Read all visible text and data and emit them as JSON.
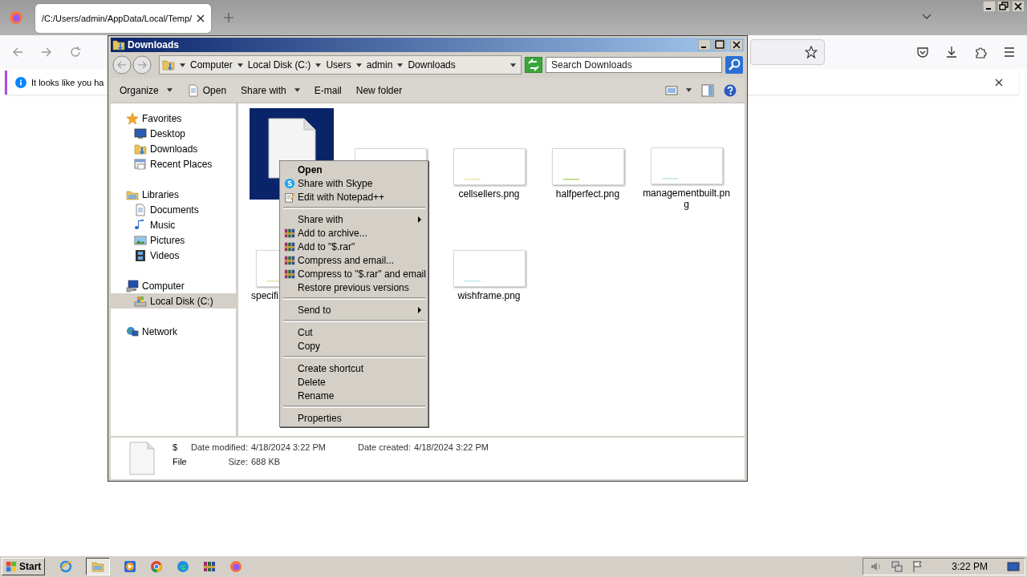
{
  "browser": {
    "tabs": [
      {
        "title": "/C:/Users/admin/AppData/Local/Temp/",
        "selected": true
      }
    ],
    "notification": "It looks like you ha"
  },
  "explorer": {
    "title": "Downloads",
    "breadcrumb": [
      "Computer",
      "Local Disk (C:)",
      "Users",
      "admin",
      "Downloads"
    ],
    "search": {
      "placeholder": "Search Downloads"
    },
    "commands": [
      {
        "label": "Organize",
        "menu": true
      },
      {
        "label": "Open",
        "menu": false
      },
      {
        "label": "Share with",
        "menu": true
      },
      {
        "label": "E-mail",
        "menu": false
      },
      {
        "label": "New folder",
        "menu": false
      }
    ],
    "nav": [
      {
        "label": "Favorites",
        "selected": false,
        "children": [
          {
            "label": "Desktop",
            "selected": false
          },
          {
            "label": "Downloads",
            "selected": false
          },
          {
            "label": "Recent Places",
            "selected": false
          }
        ]
      },
      {
        "label": "Libraries",
        "selected": false,
        "children": [
          {
            "label": "Documents",
            "selected": false
          },
          {
            "label": "Music",
            "selected": false
          },
          {
            "label": "Pictures",
            "selected": false
          },
          {
            "label": "Videos",
            "selected": false
          }
        ]
      },
      {
        "label": "Computer",
        "selected": false,
        "children": [
          {
            "label": "Local Disk (C:)",
            "selected": true
          }
        ]
      },
      {
        "label": "Network",
        "selected": false
      }
    ],
    "files": [
      {
        "kind": "document",
        "selected": true
      },
      {
        "kind": "image",
        "selected": false
      },
      {
        "kind": "image",
        "label": "cellsellers.png",
        "selected": false
      },
      {
        "kind": "image",
        "label": "halfperfect.png",
        "selected": false
      },
      {
        "kind": "image",
        "label": "managementbuilt.png",
        "selected": false
      },
      {
        "kind": "image",
        "label": "specifi",
        "selected": false
      },
      {
        "kind": "empty"
      },
      {
        "kind": "image",
        "label": "wishframe.png",
        "selected": false
      }
    ],
    "details": {
      "name": "$",
      "type": "File",
      "fields": [
        {
          "label": "Date modified:",
          "value": "4/18/2024 3:22 PM"
        },
        {
          "label": "Date created:",
          "value": "4/18/2024 3:22 PM"
        },
        {
          "label": "Size:",
          "value": "688 KB"
        }
      ]
    }
  },
  "context_menu": {
    "groups": [
      [
        {
          "label": "Open",
          "default": true,
          "submenu": false
        },
        {
          "label": "Share with Skype",
          "kind": "skype",
          "default": false,
          "submenu": false
        },
        {
          "label": "Edit with Notepad++",
          "kind": "notepad",
          "default": false,
          "submenu": false
        }
      ],
      [
        {
          "label": "Share with",
          "default": false,
          "submenu": true
        },
        {
          "label": "Add to archive...",
          "kind": "archive",
          "default": false,
          "submenu": false
        },
        {
          "label": "Add to \"$.rar\"",
          "kind": "archive",
          "default": false,
          "submenu": false
        },
        {
          "label": "Compress and email...",
          "kind": "archive",
          "default": false,
          "submenu": false
        },
        {
          "label": "Compress to \"$.rar\" and email",
          "kind": "archive",
          "default": false,
          "submenu": false
        },
        {
          "label": "Restore previous versions",
          "default": false,
          "submenu": false
        }
      ],
      [
        {
          "label": "Send to",
          "default": false,
          "submenu": true
        }
      ],
      [
        {
          "label": "Cut",
          "default": false,
          "submenu": false
        },
        {
          "label": "Copy",
          "default": false,
          "submenu": false
        }
      ],
      [
        {
          "label": "Create shortcut",
          "default": false,
          "submenu": false
        },
        {
          "label": "Delete",
          "default": false,
          "submenu": false
        },
        {
          "label": "Rename",
          "default": false,
          "submenu": false
        }
      ],
      [
        {
          "label": "Properties",
          "default": false,
          "submenu": false
        }
      ]
    ]
  },
  "taskbar": {
    "start": "Start",
    "clock": "3:22 PM"
  }
}
